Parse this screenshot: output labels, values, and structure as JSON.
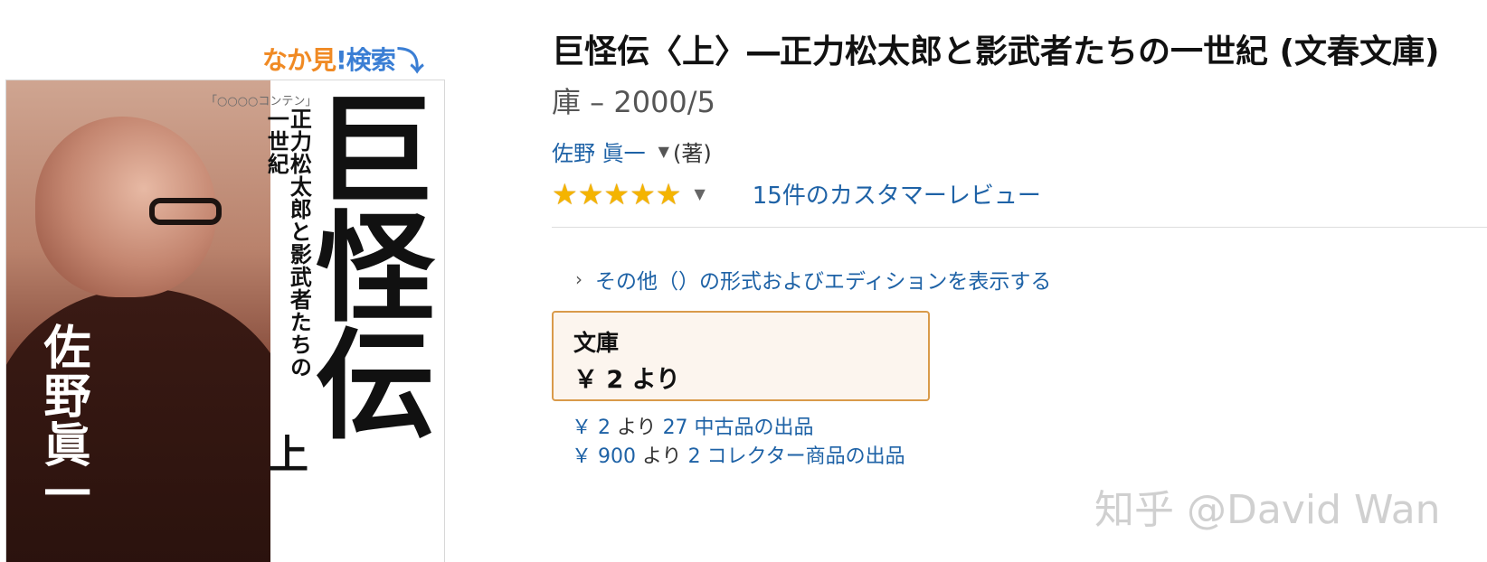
{
  "look_inside": {
    "part1": "なか見",
    "part2": "!検索",
    "arrow": "⤵",
    "icon": "down-arrow-icon"
  },
  "cover": {
    "series_mark": "「○○○○コンテン」",
    "title": "巨怪伝",
    "volume": "上",
    "subtitle": "正力松太郎と影武者たちの一世紀",
    "author": "佐野眞一"
  },
  "product": {
    "title": "巨怪伝〈上〉―正力松太郎と影武者たちの一世紀 (文春文庫)",
    "meta": "庫 – 2000/5",
    "author": "佐野 眞一",
    "author_role": "(著)",
    "rating_stars": 5,
    "review_link": "15件のカスタマーレビュー"
  },
  "other_formats": {
    "label": "その他（）の形式およびエディションを表示する",
    "icon": "chevron-right-icon"
  },
  "format_box": {
    "name": "文庫",
    "price": "￥ 2 より"
  },
  "offers": [
    {
      "price": "￥ 2",
      "yori": "より",
      "rest": "27 中古品の出品"
    },
    {
      "price": "￥ 900",
      "yori": "より",
      "rest": "2 コレクター商品の出品"
    }
  ],
  "watermark": "知乎 @David Wan",
  "colors": {
    "link": "#1e62a6",
    "star": "#f4b400",
    "format_border": "#d99a4a",
    "format_bg": "#fcf5ee",
    "look_inside_orange": "#f08a24",
    "look_inside_blue": "#3a7ed4"
  }
}
